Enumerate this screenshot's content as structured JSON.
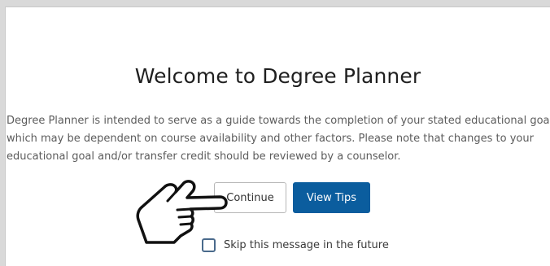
{
  "dialog": {
    "title": "Welcome to Degree Planner",
    "description_lines": [
      "Degree Planner is intended to serve as a guide towards the completion of your stated educational goal",
      "which may be dependent on course availability and other factors. Please note that changes to your",
      "educational goal and/or transfer credit should be reviewed by a counselor."
    ],
    "buttons": {
      "continue_label": "Continue",
      "view_tips_label": "View Tips"
    },
    "skip_checkbox": {
      "label": "Skip this message in the future",
      "checked": false
    }
  },
  "overlay": {
    "pointer_icon": "hand-pointer-icon"
  },
  "colors": {
    "primary_button": "#0b5d9e",
    "background": "#d9d9d9",
    "dialog_background": "#ffffff"
  }
}
